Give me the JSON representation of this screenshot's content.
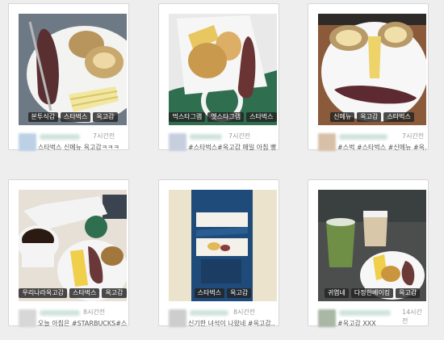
{
  "cards": [
    {
      "tags": [
        "본투식감",
        "스타벅스",
        "옥고감"
      ],
      "time": "7시간전",
      "caption": "스타벅스 신메뉴 옥고감ㅋㅋㅋ",
      "avatar_color": "#bcd1e6"
    },
    {
      "tags": [
        "먹스타그램",
        "옛스타그램",
        "스타벅스"
      ],
      "time": "7시간전",
      "caption": "#스타벅스#옥고감 매일 아침 빵..",
      "avatar_color": "#c7cfdf"
    },
    {
      "tags": [
        "신메뉴",
        "옥고감",
        "스타벅스"
      ],
      "time": "7시간전",
      "caption": "#스벅 #스타벅스 #신메뉴 #옥..",
      "avatar_color": "#d8c0a8"
    },
    {
      "tags": [
        "우리나라옥고감",
        "스타벅스",
        "옥고감"
      ],
      "time": "8시간전",
      "caption": "오늘 아침은 #STARBUCKS#스..",
      "avatar_color": "#d7d7d7"
    },
    {
      "tags": [
        "스타벅스",
        "옥고감"
      ],
      "time": "8시간전",
      "caption": "신기한 녀석이 나왔네 #옥고감..",
      "avatar_color": "#cdcdcd"
    },
    {
      "tags": [
        "귀엽네",
        "다정한베이킹",
        "옥고감"
      ],
      "time": "14시간전",
      "caption": "#옥고감 ⅩⅩⅩ",
      "avatar_color": "#a9b7a5"
    }
  ]
}
